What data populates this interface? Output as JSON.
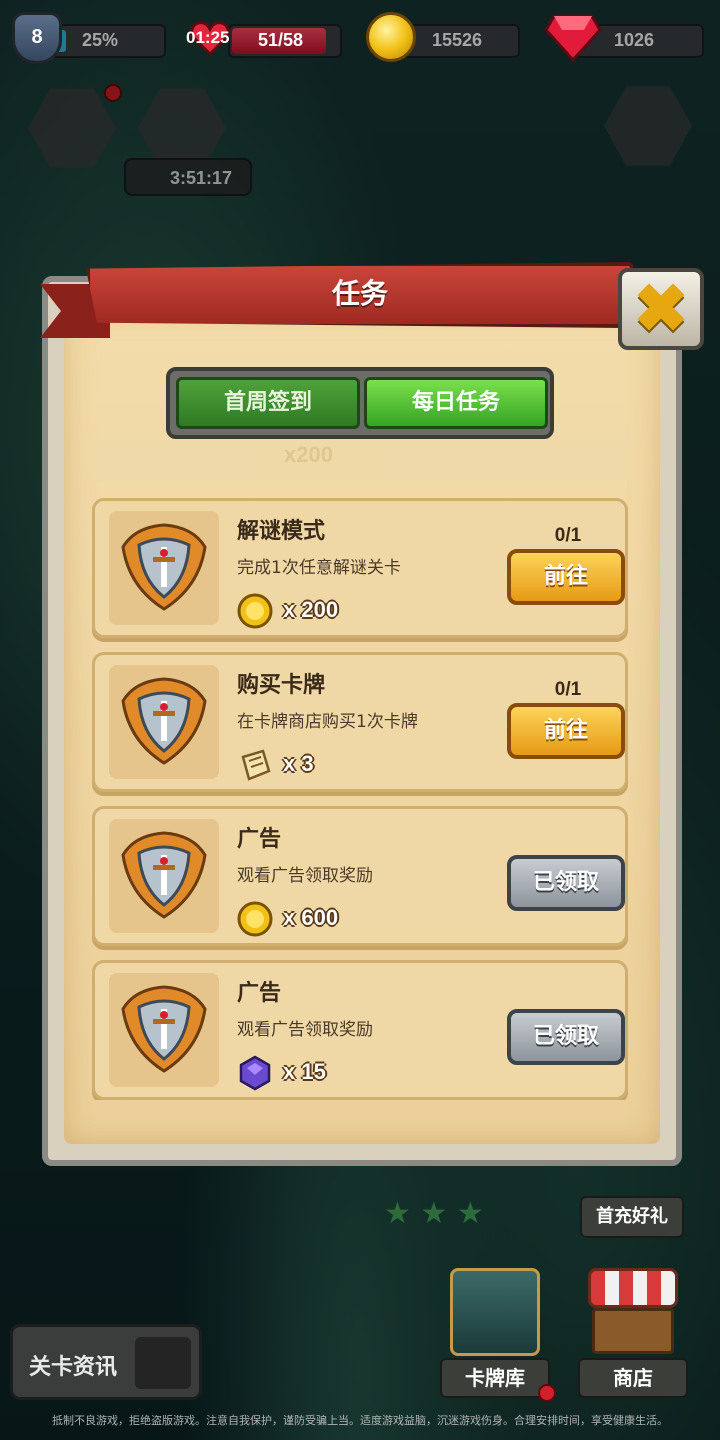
{
  "status_bar": {
    "level": "8",
    "exp_percent": "25%",
    "energy_timer": "01:25",
    "energy": "51/58",
    "gold": "15526",
    "gems": "1026"
  },
  "hud": {
    "chest_timer": "3:51:17"
  },
  "modal": {
    "title": "任务",
    "close_glyph": "✖",
    "tabs": [
      {
        "label": "首周签到",
        "active": false
      },
      {
        "label": "每日任务",
        "active": true
      }
    ],
    "ghost_reward": "x200",
    "tasks": [
      {
        "title": "解谜模式",
        "desc": "完成1次任意解谜关卡",
        "reward_icon": "coin-icon",
        "reward": "x 200",
        "progress": "0/1",
        "button": "前往",
        "state": "go"
      },
      {
        "title": "购买卡牌",
        "desc": "在卡牌商店购买1次卡牌",
        "reward_icon": "scroll-icon",
        "reward": "x 3",
        "progress": "0/1",
        "button": "前往",
        "state": "go"
      },
      {
        "title": "广告",
        "desc": "观看广告领取奖励",
        "reward_icon": "coin-icon",
        "reward": "x 600",
        "progress": "",
        "button": "已领取",
        "state": "claimed"
      },
      {
        "title": "广告",
        "desc": "观看广告领取奖励",
        "reward_icon": "purple-gem-icon",
        "reward": "x 15",
        "progress": "",
        "button": "已领取",
        "state": "claimed"
      }
    ]
  },
  "bottom": {
    "first_charge": "首充好礼",
    "level_info": "关卡资讯",
    "deck": "卡牌库",
    "shop": "商店"
  },
  "footer": "抵制不良游戏，拒绝盗版游戏。注意自我保护，谨防受骗上当。适度游戏益脑，沉迷游戏伤身。合理安排时间，享受健康生活。",
  "colors": {
    "tab_active": "#5ccc3a",
    "go_button": "#f4b52a",
    "claimed_button": "#9aa1a8",
    "ribbon": "#b8372d"
  }
}
